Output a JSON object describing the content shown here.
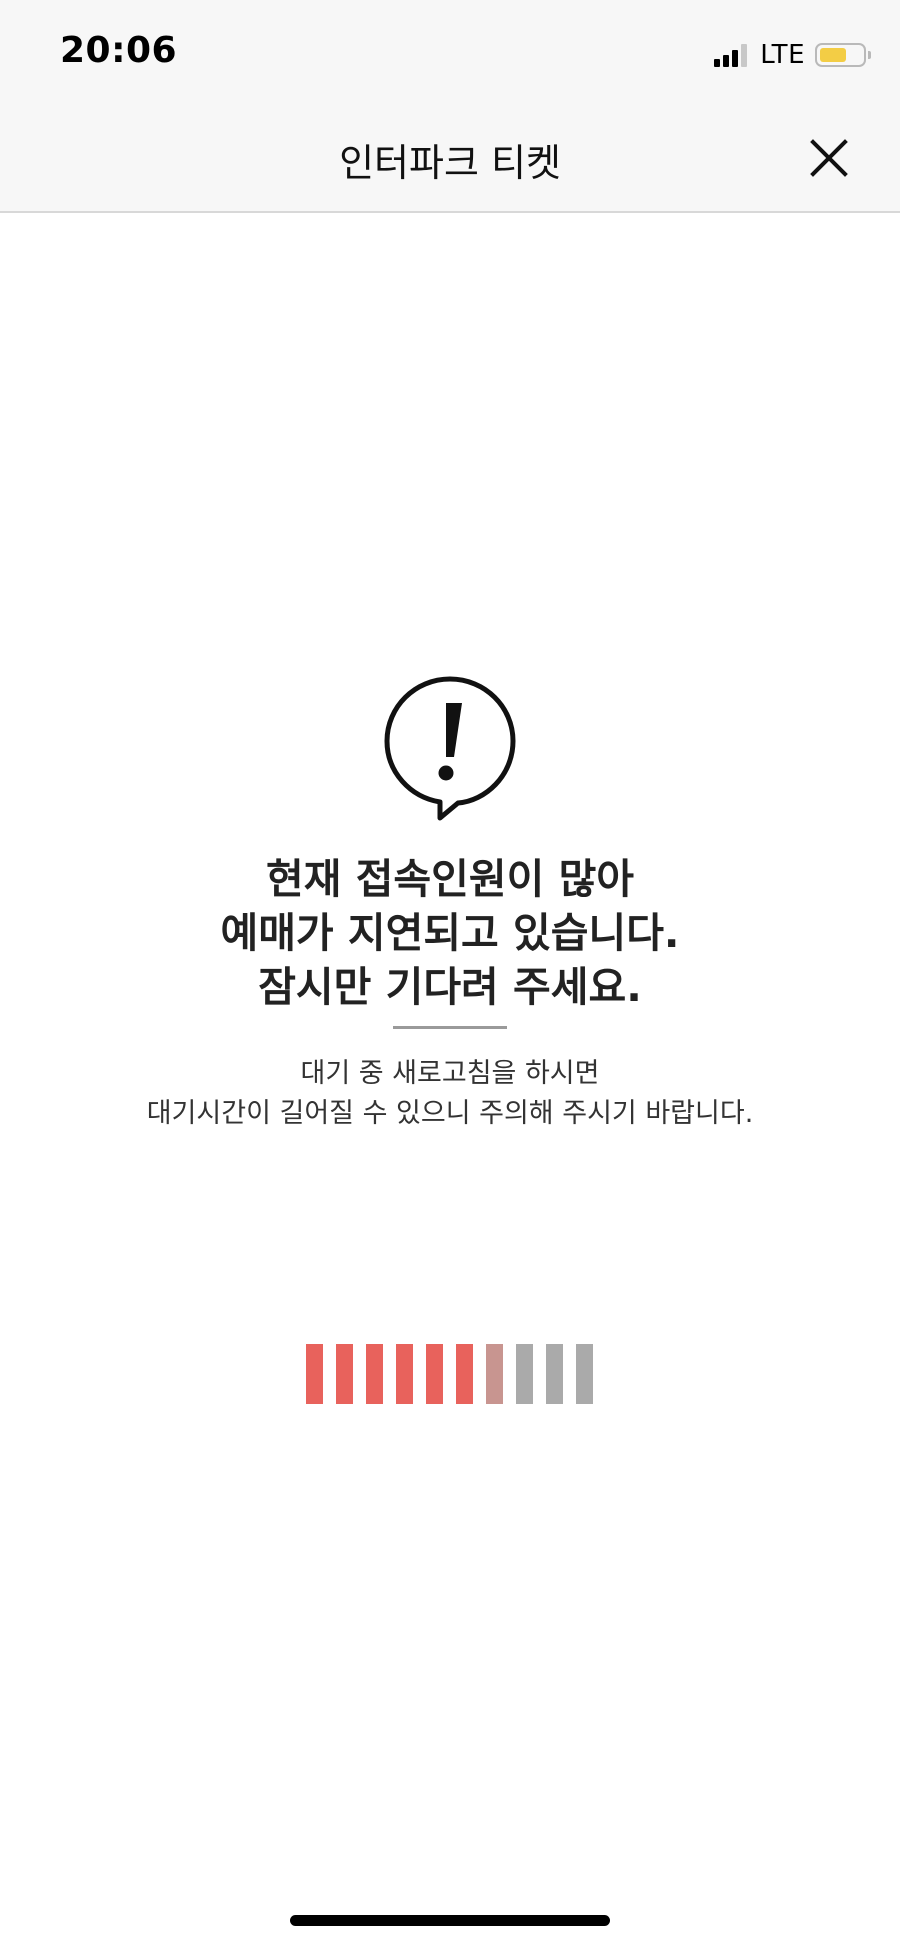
{
  "status_bar": {
    "time": "20:06",
    "network": "LTE",
    "battery_color": "#f3cd45"
  },
  "header": {
    "title": "인터파크 티켓",
    "close_icon": "close-icon"
  },
  "notice": {
    "icon": "exclamation-speech-bubble-icon",
    "headline": [
      "현재 접속인원이 많아",
      "예매가 지연되고 있습니다.",
      "잠시만 기다려 주세요."
    ],
    "subtext": [
      "대기 중 새로고침을 하시면",
      "대기시간이 길어질 수 있으니 주의해 주시기 바랍니다."
    ]
  },
  "loader": {
    "segments_total": 10,
    "segments_filled": 6,
    "filled_color": "#e8625c",
    "transition_color": "#c89590",
    "empty_color": "#aaaaaa"
  }
}
